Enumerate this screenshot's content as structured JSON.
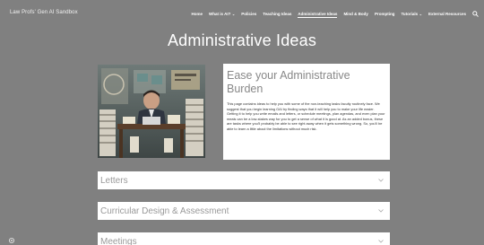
{
  "site": {
    "title": "Law Profs' Gen AI Sandbox"
  },
  "nav": {
    "items": [
      {
        "label": "Home",
        "caret": false,
        "active": false
      },
      {
        "label": "What is AI?",
        "caret": true,
        "active": false
      },
      {
        "label": "Policies",
        "caret": false,
        "active": false
      },
      {
        "label": "Teaching Ideas",
        "caret": false,
        "active": false
      },
      {
        "label": "Administrative Ideas",
        "caret": false,
        "active": true
      },
      {
        "label": "Mind & Body",
        "caret": false,
        "active": false
      },
      {
        "label": "Prompting",
        "caret": false,
        "active": false
      },
      {
        "label": "Tutorials",
        "caret": true,
        "active": false
      },
      {
        "label": "External Resources",
        "caret": false,
        "active": false
      }
    ],
    "search_icon": "search-icon"
  },
  "page": {
    "title": "Administrative Ideas"
  },
  "intro": {
    "heading": "Ease your Administrative Burden",
    "body": "This page contains ideas to help you with some of the non-teaching tasks faculty routinely face. We suggest that you begin learning GAI by finding ways that it will help you to make your life easier. Getting it to help you write emails and letters, or schedule meetings, plan agendas, and even plan your meals can be a low-stakes way for you to get a sense of what it is good at. As an added bonus, these are tasks where you'll probably be able to see right away when it gets something wrong. So, you'll be able to learn a little about the limitations without much risk."
  },
  "accordions": [
    {
      "label": "Letters"
    },
    {
      "label": "Curricular Design & Assessment"
    },
    {
      "label": "Meetings"
    }
  ],
  "colors": {
    "background": "#808080",
    "card": "#ffffff",
    "heading_gray": "#888888"
  }
}
